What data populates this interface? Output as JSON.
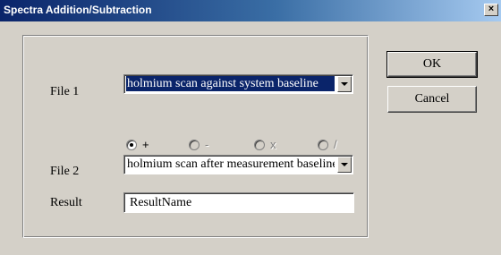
{
  "window": {
    "title": "Spectra Addition/Subtraction",
    "close_glyph": "×"
  },
  "form": {
    "file1_label": "File 1",
    "file1_value": "holmium scan against system baseline",
    "file2_label": "File 2",
    "file2_value": "holmium scan after measurement baseline",
    "result_label": "Result",
    "result_value": "ResultName"
  },
  "operations": [
    {
      "label": "+",
      "checked": true,
      "enabled": true
    },
    {
      "label": "-",
      "checked": false,
      "enabled": false
    },
    {
      "label": "x",
      "checked": false,
      "enabled": false
    },
    {
      "label": "/",
      "checked": false,
      "enabled": false
    }
  ],
  "buttons": {
    "ok_label": "OK",
    "cancel_label": "Cancel"
  },
  "colors": {
    "titlebar_start": "#0a246a",
    "titlebar_end": "#a6caf0",
    "face": "#d4d0c8",
    "selection": "#0a246a"
  }
}
